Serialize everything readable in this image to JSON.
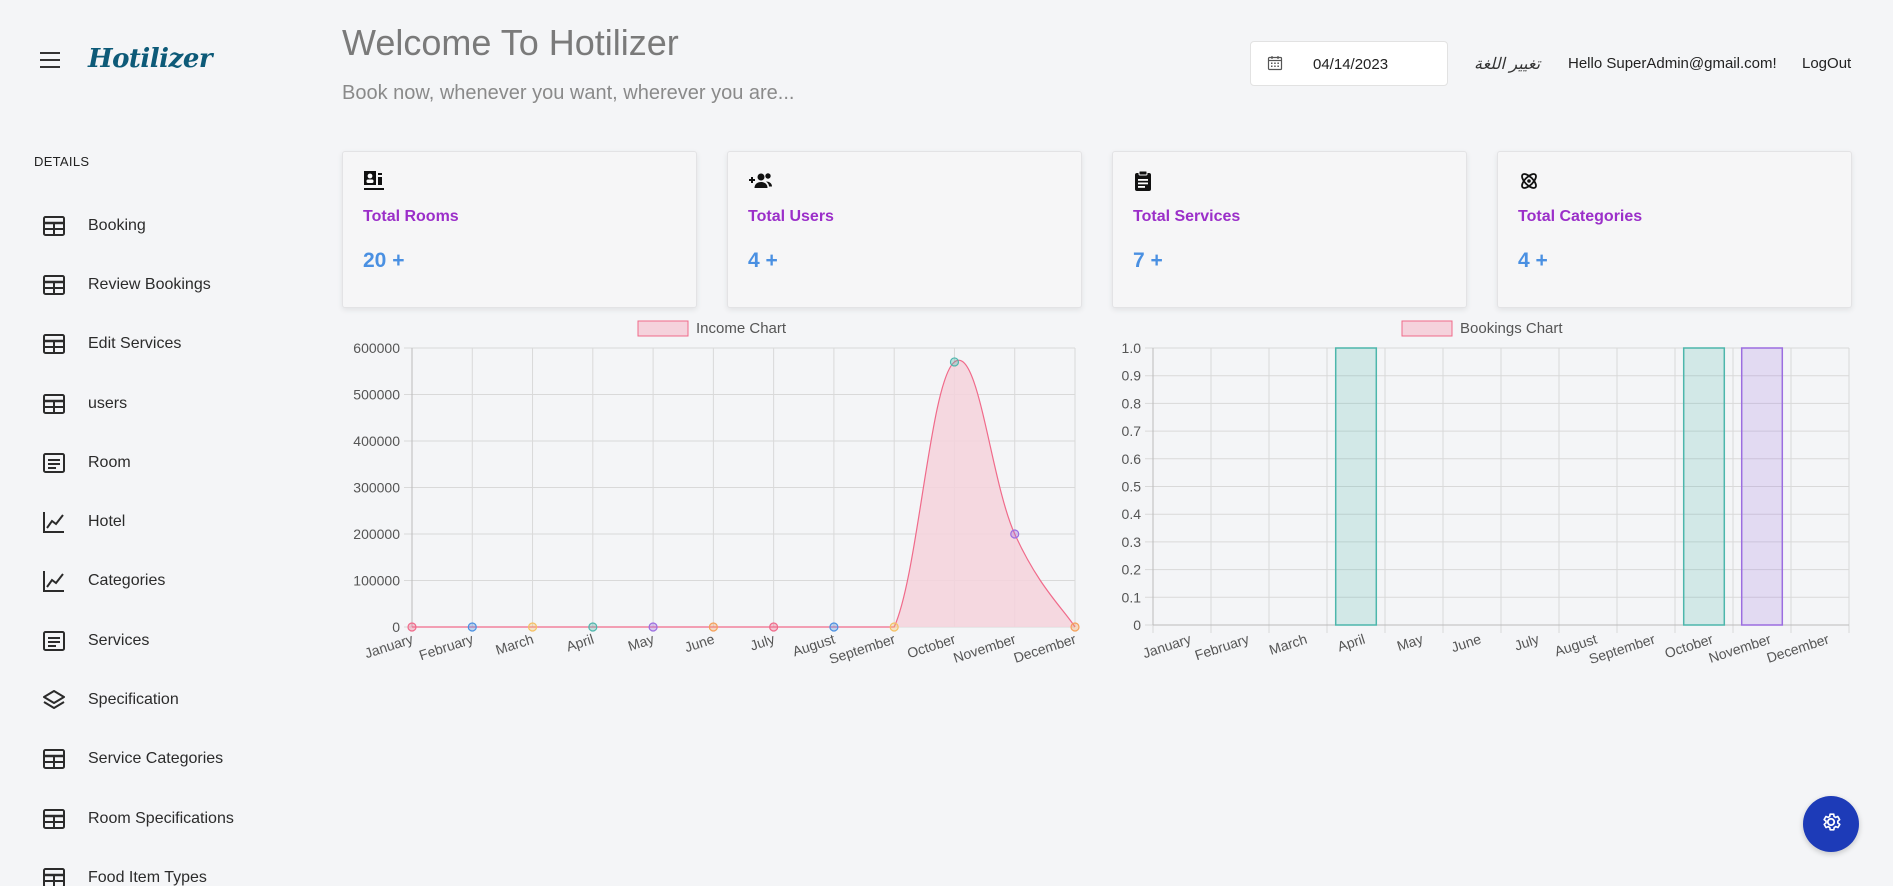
{
  "app": {
    "logo": "Hotilizer"
  },
  "sidebar": {
    "section_title": "DETAILS",
    "items": [
      {
        "label": "Booking",
        "icon": "table-icon"
      },
      {
        "label": "Review Bookings",
        "icon": "table-icon"
      },
      {
        "label": "Edit Services",
        "icon": "table-icon"
      },
      {
        "label": "users",
        "icon": "table-icon"
      },
      {
        "label": "Room",
        "icon": "list-box-icon"
      },
      {
        "label": "Hotel",
        "icon": "line-chart-icon"
      },
      {
        "label": "Categories",
        "icon": "line-chart-icon"
      },
      {
        "label": "Services",
        "icon": "list-box-icon"
      },
      {
        "label": "Specification",
        "icon": "layers-icon"
      },
      {
        "label": "Service Categories",
        "icon": "table-icon"
      },
      {
        "label": "Room Specifications",
        "icon": "table-icon"
      },
      {
        "label": "Food Item Types",
        "icon": "table-icon"
      }
    ]
  },
  "header": {
    "title": "Welcome To Hotilizer",
    "tagline": "Book now, whenever you want, wherever you are...",
    "date": "04/14/2023",
    "language_toggle": "تغيير اللغة",
    "greeting": "Hello SuperAdmin@gmail.com!",
    "logout": "LogOut"
  },
  "cards": [
    {
      "title": "Total Rooms",
      "value": "20 +",
      "icon": "room-badge-icon"
    },
    {
      "title": "Total Users",
      "value": "4 +",
      "icon": "add-users-icon"
    },
    {
      "title": "Total Services",
      "value": "7 +",
      "icon": "clipboard-icon"
    },
    {
      "title": "Total Categories",
      "value": "4 +",
      "icon": "atom-icon"
    }
  ],
  "colors": {
    "card_title": "#9b2fc9",
    "card_value": "#4a90e2",
    "income_line": "#f06a8a",
    "income_fill": "#f5d2dc",
    "fab": "#1d3bb8"
  },
  "chart_data": [
    {
      "type": "area",
      "legend": "Income Chart",
      "categories": [
        "January",
        "February",
        "March",
        "April",
        "May",
        "June",
        "July",
        "August",
        "September",
        "October",
        "November",
        "December"
      ],
      "values": [
        0,
        0,
        0,
        0,
        0,
        0,
        0,
        0,
        0,
        570000,
        200000,
        0
      ],
      "ylim": [
        0,
        600000
      ],
      "yticks": [
        0,
        100000,
        200000,
        300000,
        400000,
        500000,
        600000
      ],
      "point_colors": [
        "#f06a8a",
        "#4a90e2",
        "#f5c063",
        "#4db6ac",
        "#9b6de0",
        "#f5a05a",
        "#f06a8a",
        "#4a90e2",
        "#f5c063",
        "#4db6ac",
        "#9b6de0",
        "#f5a05a"
      ],
      "grid": true,
      "legend_position": "top"
    },
    {
      "type": "bar",
      "legend": "Bookings Chart",
      "categories": [
        "January",
        "February",
        "March",
        "April",
        "May",
        "June",
        "July",
        "August",
        "September",
        "October",
        "November",
        "December"
      ],
      "values": [
        0,
        0,
        0,
        1,
        0,
        0,
        0,
        0,
        0,
        1,
        1,
        0
      ],
      "ylim": [
        0,
        1
      ],
      "yticks": [
        "0",
        "0.1",
        "0.2",
        "0.3",
        "0.4",
        "0.5",
        "0.6",
        "0.7",
        "0.8",
        "0.9",
        "1.0"
      ],
      "bar_colors": [
        "#f06a8a",
        "#4a90e2",
        "#f5c063",
        "#4db6ac",
        "#9b6de0",
        "#f5a05a",
        "#f06a8a",
        "#4a90e2",
        "#f5c063",
        "#4db6ac",
        "#9b6de0",
        "#f5a05a"
      ],
      "grid": true,
      "legend_position": "top"
    }
  ]
}
